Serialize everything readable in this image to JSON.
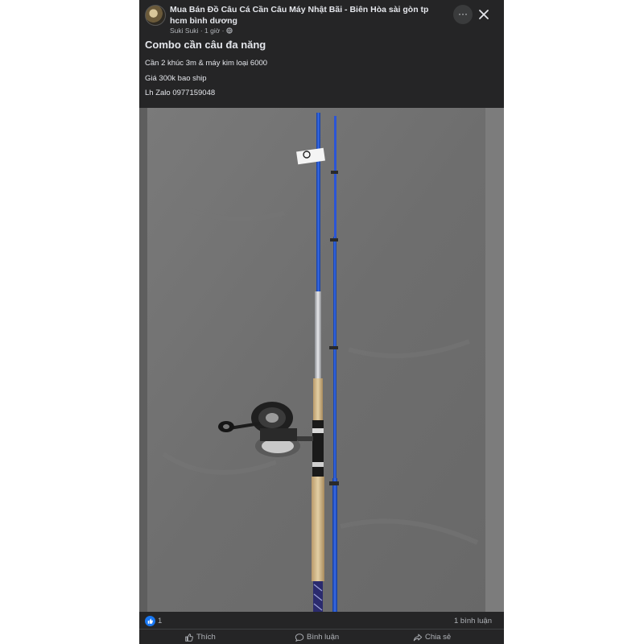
{
  "post": {
    "group_name": "Mua Bán Đồ Câu Cá Cần Câu Máy Nhật Bãi - Biên Hòa sài gòn tp hcm bình dương",
    "author": "Suki Suki",
    "time": "1 giờ",
    "more_label": "···",
    "title": "Combo cần câu đa năng",
    "lines": [
      "Cần 2 khúc 3m & máy kim loại 6000",
      "Giá 300k bao ship",
      "Lh Zalo 0977159048"
    ]
  },
  "reactions": {
    "like_count": "1",
    "comment_count": "1 bình luận"
  },
  "actions": {
    "like": "Thích",
    "comment": "Bình luận",
    "share": "Chia sẻ"
  },
  "colors": {
    "panel": "#252526",
    "text": "#e4e6eb",
    "muted": "#b0b3b8",
    "like_blue": "#1877f2",
    "rod_blue": "#1f4fc9"
  },
  "icons": [
    "avatar",
    "globe-icon",
    "more-icon",
    "close-icon",
    "like-badge-icon",
    "thumb-up-icon",
    "comment-icon",
    "share-icon"
  ]
}
